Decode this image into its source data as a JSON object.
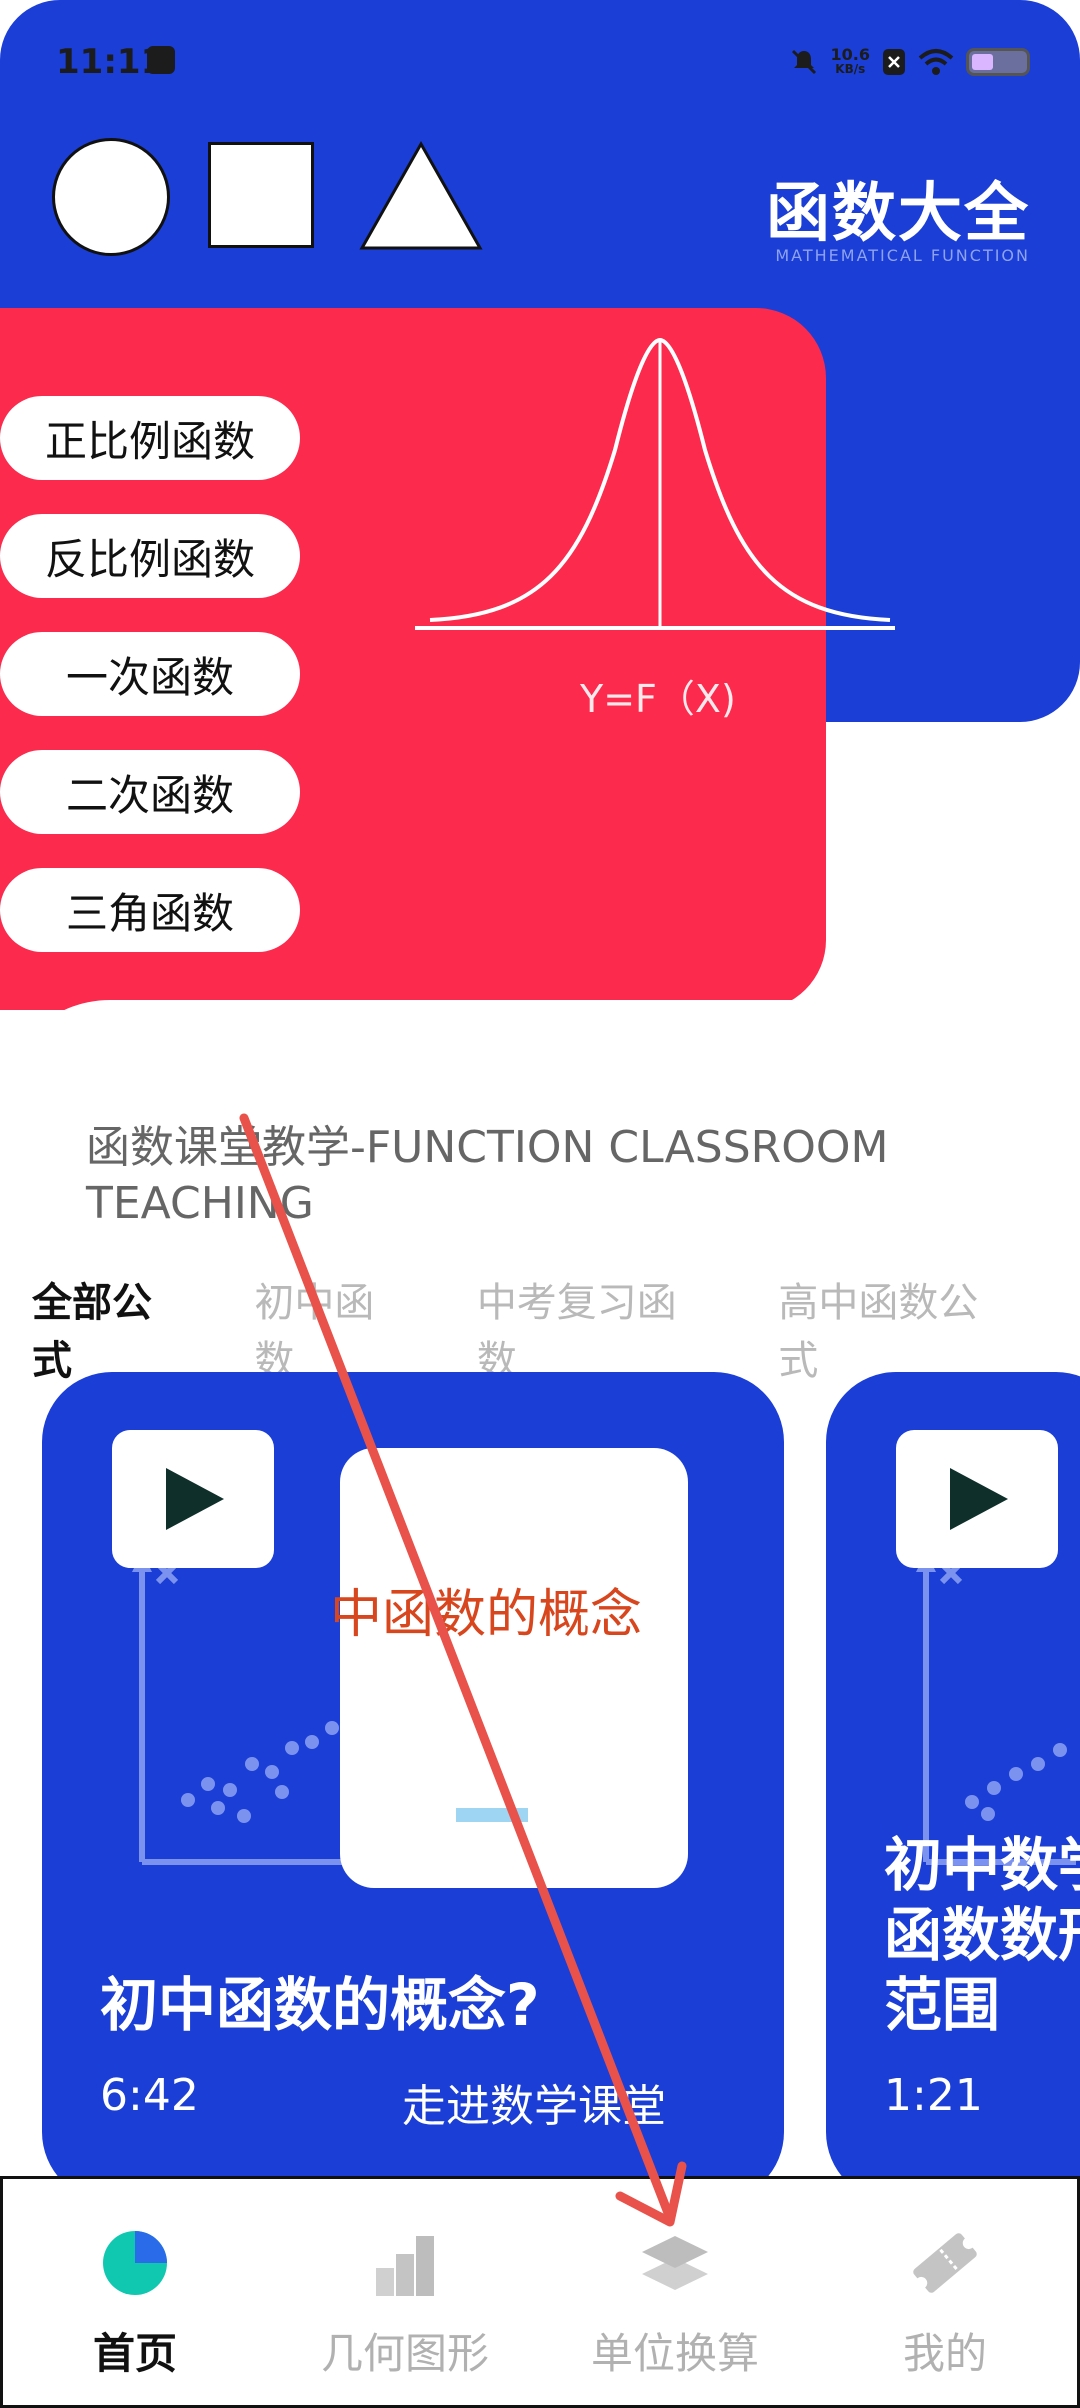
{
  "status_bar": {
    "time": "11:11",
    "net_speed_value": "10.6",
    "net_speed_unit": "KB/s"
  },
  "header": {
    "title": "函数大全",
    "subtitle": "MATHEMATICAL FUNCTION",
    "shapes": [
      "circle-icon",
      "square-icon",
      "triangle-icon"
    ]
  },
  "function_types": [
    {
      "label": "正比例函数"
    },
    {
      "label": "反比例函数"
    },
    {
      "label": "一次函数"
    },
    {
      "label": "二次函数"
    },
    {
      "label": "三角函数"
    }
  ],
  "graph": {
    "formula": "Y=F（X)"
  },
  "section": {
    "title": "函数课堂教学-FUNCTION CLASSROOM TEACHING"
  },
  "tabs": [
    {
      "label": "全部公式",
      "active": true
    },
    {
      "label": "初中函数",
      "active": false
    },
    {
      "label": "中考复习函数",
      "active": false
    },
    {
      "label": "高中函数公式",
      "active": false
    }
  ],
  "videos": [
    {
      "thumb_text": "中函数的概念",
      "title": "初中函数的概念?",
      "duration": "6:42",
      "channel": "走进数学课堂"
    },
    {
      "title_line1": "初中数学",
      "title_line2": "函数数形",
      "title_line3": "范围",
      "duration": "1:21"
    }
  ],
  "bottom_nav": [
    {
      "label": "首页",
      "icon": "home-pie-icon",
      "active": true
    },
    {
      "label": "几何图形",
      "icon": "bar-steps-icon",
      "active": false
    },
    {
      "label": "单位换算",
      "icon": "layers-icon",
      "active": false
    },
    {
      "label": "我的",
      "icon": "ticket-icon",
      "active": false
    }
  ],
  "colors": {
    "primary_blue": "#1a3ed6",
    "accent_red": "#fc2a4d",
    "annotation_arrow": "#e8524a"
  }
}
